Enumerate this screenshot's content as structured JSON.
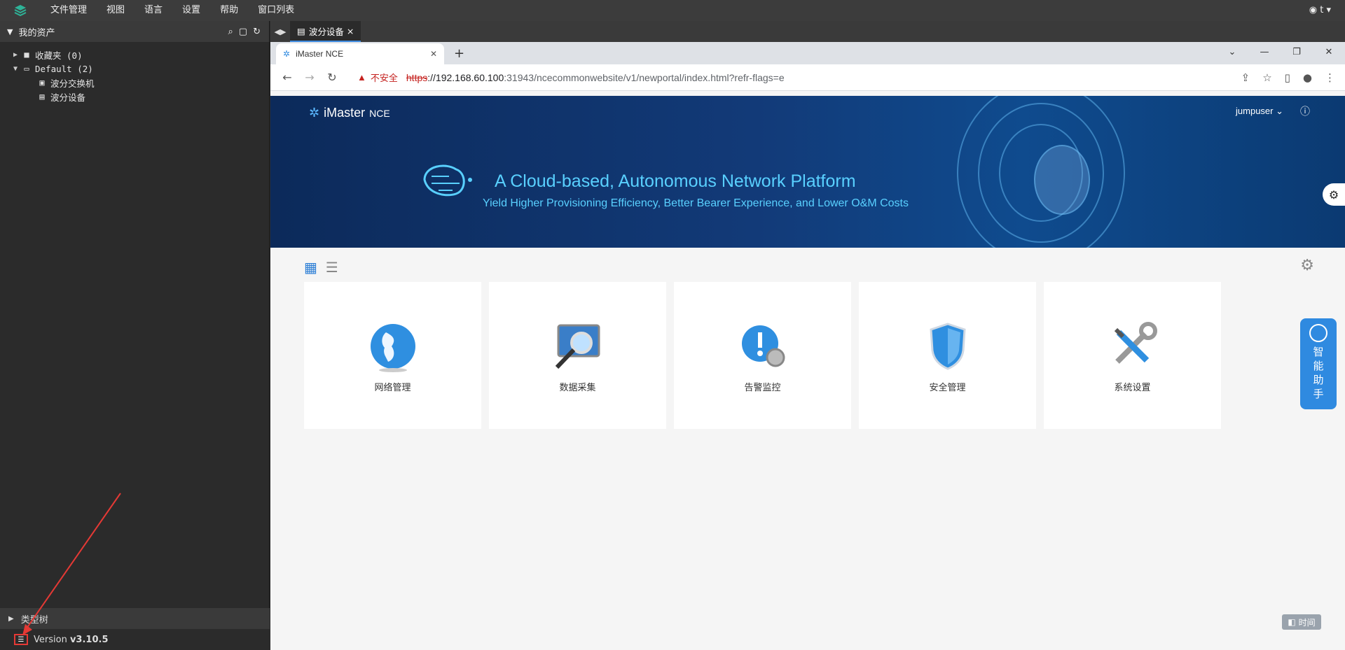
{
  "menubar": {
    "items": [
      "文件管理",
      "视图",
      "语言",
      "设置",
      "帮助",
      "窗口列表"
    ],
    "user": "t"
  },
  "sidebar": {
    "title": "我的资产",
    "tree": [
      {
        "label": "收藏夹 (0)",
        "expanded": false
      },
      {
        "label": "Default (2)",
        "expanded": true
      },
      {
        "label": "波分交换机"
      },
      {
        "label": "波分设备"
      }
    ],
    "bottom_section": "类型树",
    "version_prefix": "Version",
    "version": "v3.10.5"
  },
  "app_tab": {
    "label": "波分设备"
  },
  "browser": {
    "tab_title": "iMaster NCE",
    "insecure_label": "不安全",
    "url_scheme": "https",
    "url_host": "://192.168.60.100",
    "url_rest": ":31943/ncecommonwebsite/v1/newportal/index.html?refr-flags=e"
  },
  "portal": {
    "brand": "iMaster",
    "brand_suffix": "NCE",
    "title": "A Cloud-based, Autonomous Network Platform",
    "subtitle": "Yield Higher Provisioning Efficiency, Better Bearer Experience, and Lower O&M Costs",
    "user": "jumpuser",
    "cards": [
      {
        "label": "网络管理",
        "icon": "globe-icon"
      },
      {
        "label": "数据采集",
        "icon": "magnifier-icon"
      },
      {
        "label": "告警监控",
        "icon": "alarm-icon"
      },
      {
        "label": "安全管理",
        "icon": "shield-icon"
      },
      {
        "label": "系统设置",
        "icon": "tools-icon"
      }
    ],
    "assistant": [
      "智",
      "能",
      "助",
      "手"
    ],
    "time_button": "时间"
  }
}
